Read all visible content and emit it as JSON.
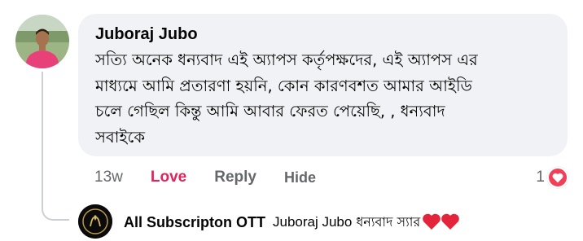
{
  "comment": {
    "author": "Juboraj Jubo",
    "text": "সত্যি অনেক ধন্যবাদ এই অ্যাপস কর্তৃপক্ষদের, এই অ্যাপস এর\nমাধ্যমে আমি প্রতারণা হয়নি, কোন কারণবশত আমার আইডি\nচলে গেছিল কিন্তু আমি আবার ফেরত পেয়েছি, , ধন্যবাদ\nসবাইকে",
    "time": "13w",
    "like_label": "Love",
    "reply_label": "Reply",
    "hide_label": "Hide",
    "reaction_count": "1",
    "reaction_icon": "heart-icon",
    "colors": {
      "like": "#e0245e",
      "heart": "#f33e58",
      "bubble": "#f0f2f5",
      "muted": "#65676b"
    }
  },
  "reply": {
    "author": "All Subscripton OTT",
    "mention": "Juboraj Jubo",
    "text": "ধন্যবাদ স্যার",
    "emoji": "red-heart-icon x2"
  }
}
